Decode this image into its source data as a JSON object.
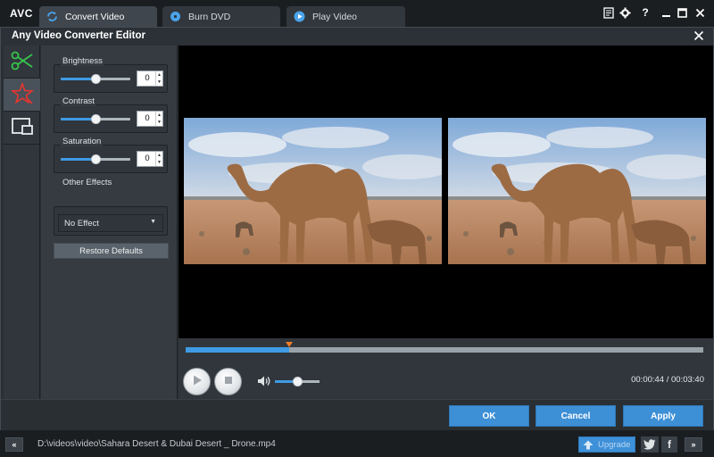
{
  "app": {
    "logo": "AVC",
    "tabs": [
      {
        "label": "Convert Video",
        "icon": "convert-icon",
        "active": true
      },
      {
        "label": "Burn DVD",
        "icon": "disc-icon",
        "active": false
      },
      {
        "label": "Play Video",
        "icon": "play-circle-icon",
        "active": false
      }
    ],
    "window_controls": [
      "list-icon",
      "gear-icon",
      "help-icon",
      "minimize-icon",
      "maximize-icon",
      "close-icon"
    ],
    "help_glyph": "?"
  },
  "editor": {
    "title": "Any Video Converter Editor",
    "rail": [
      "scissors-icon",
      "effects-star-icon",
      "crop-icon"
    ],
    "active_rail": 1,
    "brightness": {
      "label": "Brightness",
      "value": "0",
      "level": 0.5
    },
    "contrast": {
      "label": "Contrast",
      "value": "0",
      "level": 0.5
    },
    "saturation": {
      "label": "Saturation",
      "value": "0",
      "level": 0.5
    },
    "other_effects": {
      "label": "Other Effects",
      "selected": "No Effect"
    },
    "restore_label": "Restore Defaults"
  },
  "playback": {
    "progress": 0.2,
    "volume": 0.5,
    "current_time": "00:00:44",
    "total_time": "00:03:40",
    "time_separator": " / "
  },
  "buttons": {
    "ok": "OK",
    "cancel": "Cancel",
    "apply": "Apply"
  },
  "status": {
    "back": "«",
    "forward": "»",
    "file_path": "D:\\videos\\video\\Sahara Desert & Dubai Desert _ Drone.mp4",
    "upgrade": "Upgrade",
    "facebook": "f"
  },
  "colors": {
    "accent": "#3f9be3",
    "button": "#3d8fd6",
    "marker": "#f07a2a"
  }
}
